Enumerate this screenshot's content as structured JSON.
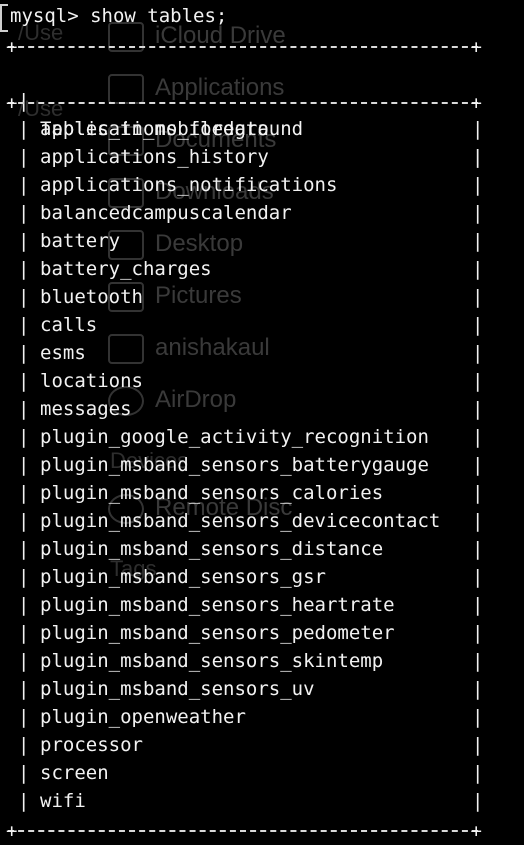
{
  "prompt": {
    "text": "mysql> show tables;"
  },
  "table": {
    "header": "Tables_in_mobiledata",
    "rows": [
      "applications_foreground",
      "applications_history",
      "applications_notifications",
      "balancedcampuscalendar",
      "battery",
      "battery_charges",
      "bluetooth",
      "calls",
      "esms",
      "locations",
      "messages",
      "plugin_google_activity_recognition",
      "plugin_msband_sensors_batterygauge",
      "plugin_msband_sensors_calories",
      "plugin_msband_sensors_devicecontact",
      "plugin_msband_sensors_distance",
      "plugin_msband_sensors_gsr",
      "plugin_msband_sensors_heartrate",
      "plugin_msband_sensors_pedometer",
      "plugin_msband_sensors_skintemp",
      "plugin_msband_sensors_uv",
      "plugin_openweather",
      "processor",
      "screen",
      "wifi"
    ]
  },
  "background_sidebar": {
    "items": [
      "iCloud Drive",
      "Applications",
      "Documents",
      "Downloads",
      "Desktop",
      "Pictures",
      "anishakaul",
      "AirDrop",
      "Remote Disc",
      "Tags"
    ],
    "fragments": [
      "/Use",
      "/Use",
      "Devices",
      "Tags"
    ]
  }
}
